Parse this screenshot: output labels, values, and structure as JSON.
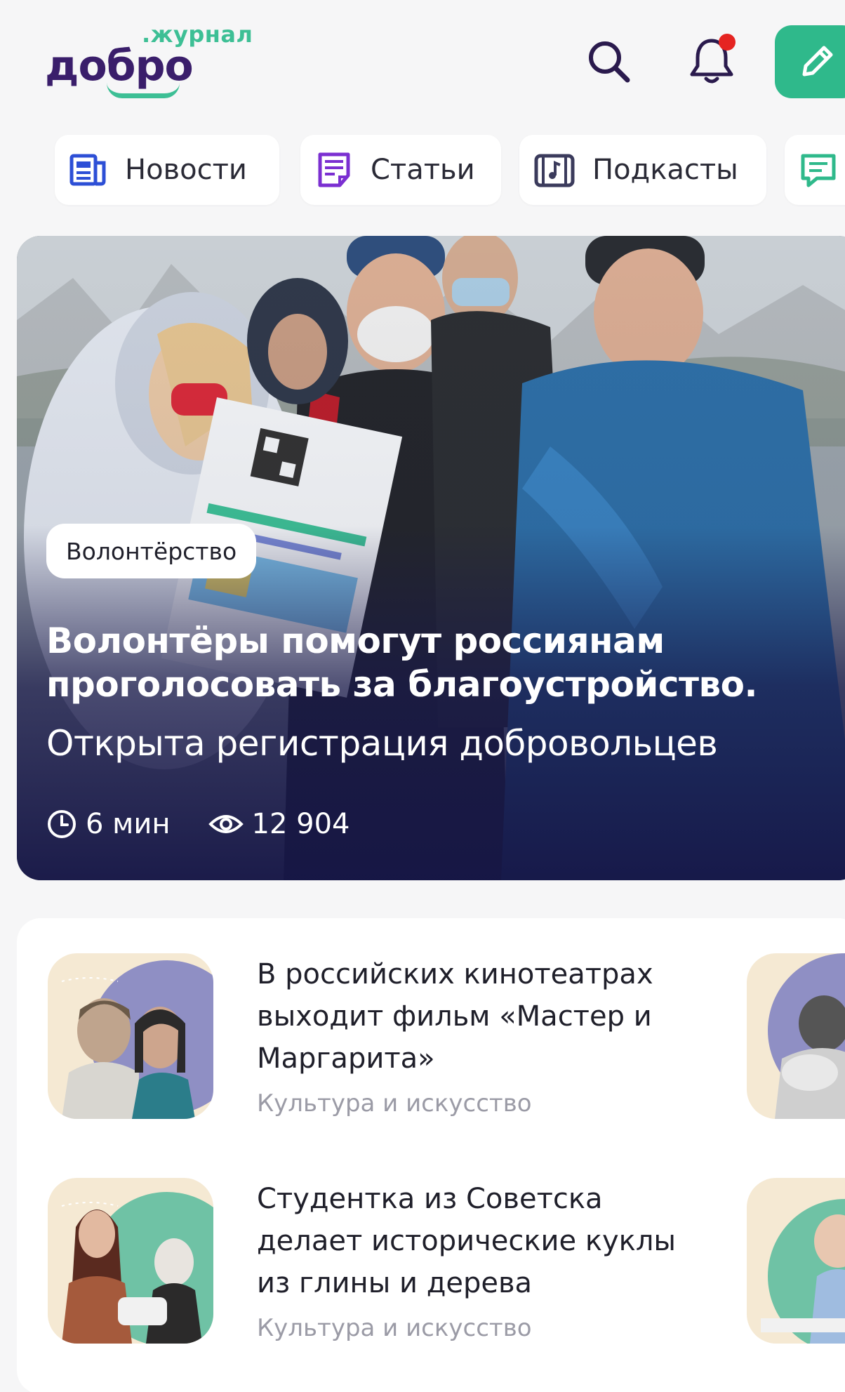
{
  "header": {
    "logo_sub": ".журнал",
    "logo_main": "добро",
    "icons": [
      "search-icon",
      "bell-icon",
      "pencil-icon"
    ],
    "notification_dot_color": "#e52421",
    "edit_button_color": "#2fb98b"
  },
  "tabs": [
    {
      "label": "Новости",
      "icon": "newspaper-icon"
    },
    {
      "label": "Статьи",
      "icon": "document-icon"
    },
    {
      "label": "Подкасты",
      "icon": "music-icon"
    },
    {
      "label": "",
      "icon": "comment-icon"
    }
  ],
  "hero": {
    "badge": "Волонтёрство",
    "title_line1": "Волонтёры помогут россиянам",
    "title_line2": "проголосовать за благоустройство.",
    "subtitle": "Открыта регистрация добровольцев",
    "read_time": "6 мин",
    "views": "12 904"
  },
  "articles": [
    {
      "title_lines": [
        "В российских кинотеатрах",
        "выходит фильм «Мастер и",
        "Маргарита»"
      ],
      "category": "Культура и искусство"
    },
    {
      "title_lines": [
        "Студентка из Советска",
        "делает исторические куклы",
        "из глины и дерева"
      ],
      "category": "Культура и искусство"
    }
  ],
  "colors": {
    "brand_purple": "#3a1e6b",
    "brand_green": "#3dbf95",
    "tab_icon_blue": "#2d4fd6",
    "tab_icon_violet": "#7b2fd1",
    "tab_icon_dark": "#3b3b5c",
    "tab_icon_green": "#2fb98b"
  }
}
